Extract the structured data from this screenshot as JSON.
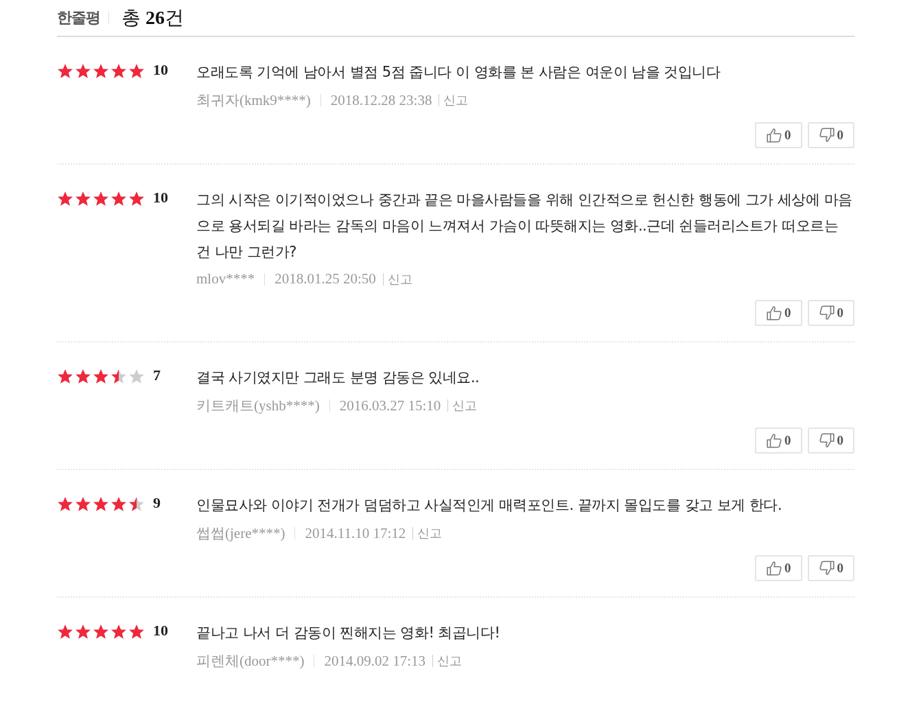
{
  "header": {
    "title": "한줄평",
    "total": "총 **26**건"
  },
  "reviews": [
    {
      "stars": 5,
      "score": "10",
      "text": "오래도록 기억에 남아서 별점 5점 줍니다 이 영화를 본 사람은 여운이 남을 것입니다",
      "author": "최귀자(kmk9****)",
      "date": "2018.12.28 23:38",
      "report": "신고",
      "likes": "0",
      "dislikes": "0"
    },
    {
      "stars": 5,
      "score": "10",
      "text": "그의 시작은 이기적이었으나 중간과 끝은 마을사람들을 위해 인간적으로 헌신한 행동에 그가 세상에 마음으로 용서되길 바라는 감독의 마음이 느껴져서 가슴이 따뜻해지는 영화..근데 쉰들러리스트가 떠오르는 건 나만 그런가?",
      "author": "mlov****",
      "date": "2018.01.25 20:50",
      "report": "신고",
      "likes": "0",
      "dislikes": "0"
    },
    {
      "stars": 3.5,
      "score": "7",
      "text": "결국 사기였지만 그래도 분명 감동은 있네요..",
      "author": "키트캐트(yshb****)",
      "date": "2016.03.27 15:10",
      "report": "신고",
      "likes": "0",
      "dislikes": "0"
    },
    {
      "stars": 4.5,
      "score": "9",
      "text": "인물묘사와 이야기 전개가 덤덤하고 사실적인게 매력포인트. 끝까지 몰입도를 갖고 보게 한다.",
      "author": "썹썹(jere****)",
      "date": "2014.11.10 17:12",
      "report": "신고",
      "likes": "0",
      "dislikes": "0"
    },
    {
      "stars": 5,
      "score": "10",
      "text": "끝나고 나서 더 감동이 찐해지는 영화! 최곱니다!",
      "author": "피렌체(door****)",
      "date": "2014.09.02 17:13",
      "report": "신고"
    }
  ]
}
